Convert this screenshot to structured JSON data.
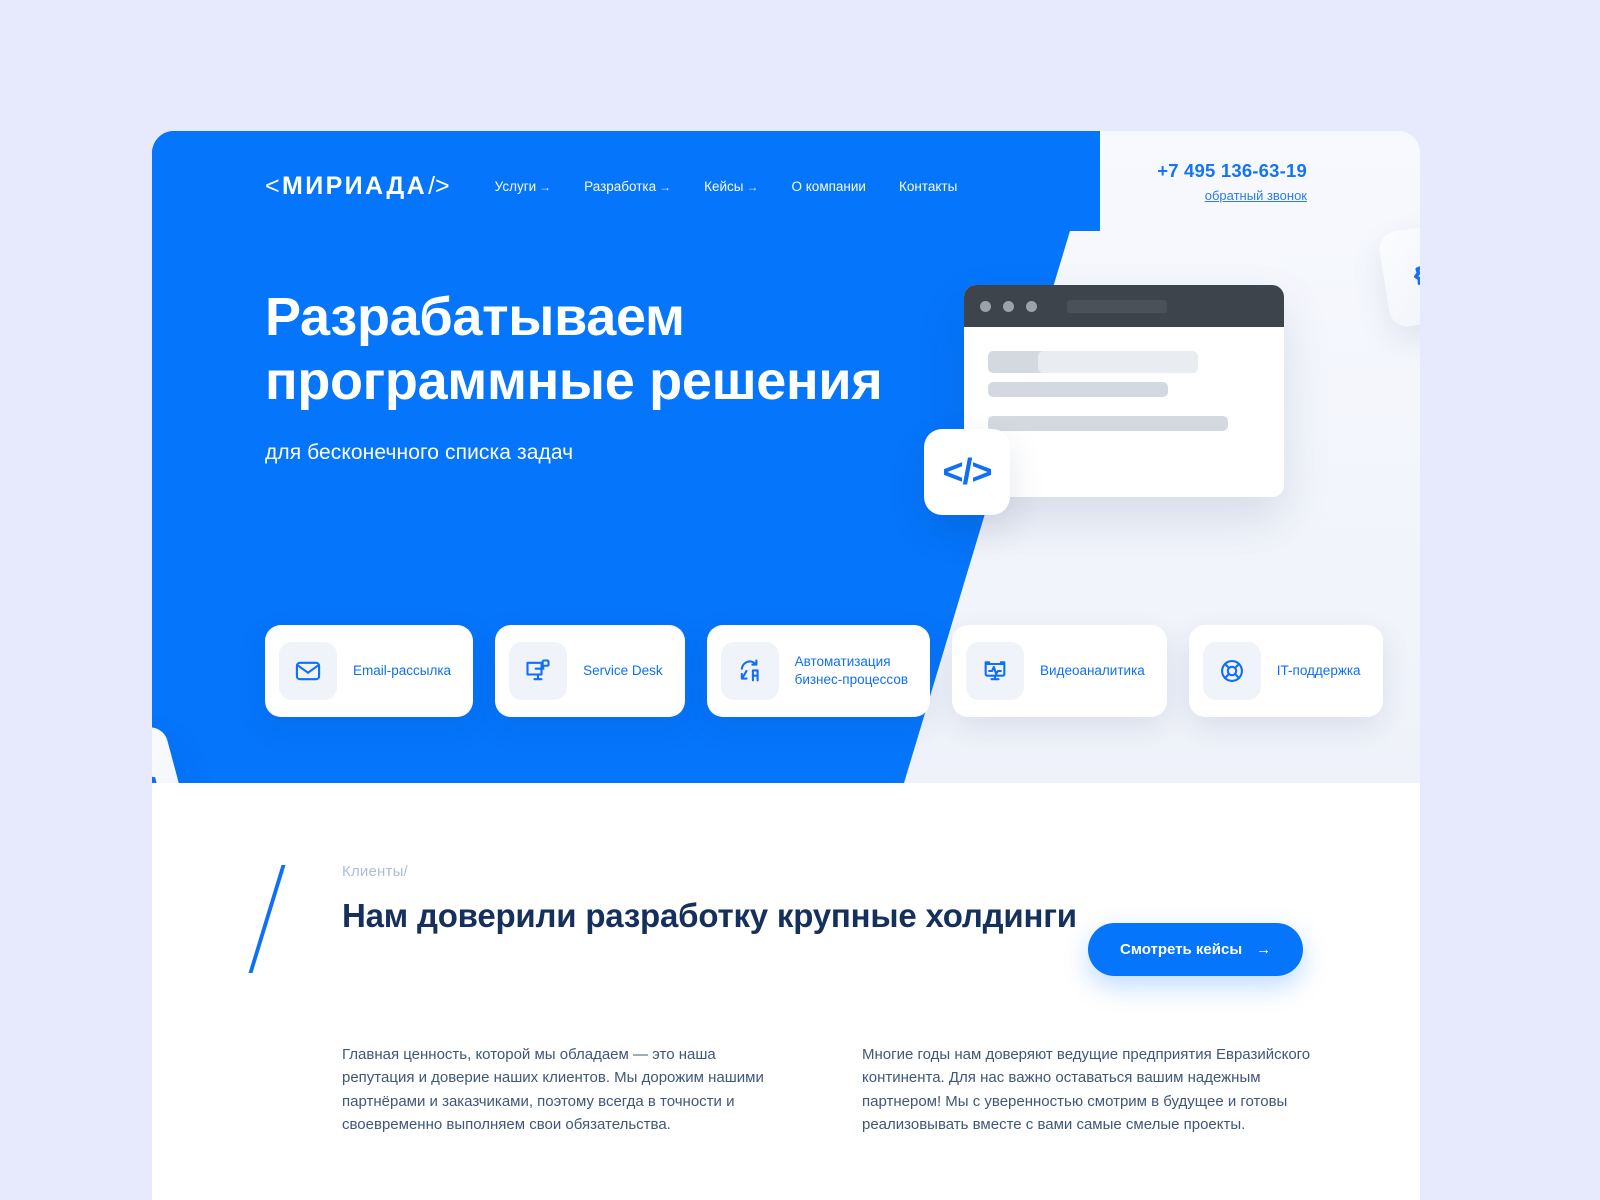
{
  "brand": {
    "logo_text": "МИРИАДА",
    "accent_color": "#0575FB",
    "dark_color": "#15305C"
  },
  "nav": {
    "items": [
      {
        "label": "Услуги",
        "arrow": "→"
      },
      {
        "label": "Разработка",
        "arrow": "→"
      },
      {
        "label": "Кейсы",
        "arrow": "→"
      },
      {
        "label": "О компании",
        "arrow": ""
      },
      {
        "label": "Контакты",
        "arrow": ""
      }
    ]
  },
  "contact": {
    "phone": "+7 495 136-63-19",
    "callback": "обратный звонок"
  },
  "hero": {
    "headline": "Разрабатываем программные решения",
    "subhead": "для бесконечного списка задач",
    "code_symbol": "</>",
    "code_symbol_bottom": "</>"
  },
  "services": [
    {
      "label": "Email-рассылка",
      "icon": "envelope-icon"
    },
    {
      "label": "Service Desk",
      "icon": "monitor-ticket-icon"
    },
    {
      "label": "Автоматизация\nбизнес-процессов",
      "icon": "automation-loop-icon"
    },
    {
      "label": "Видеоаналитика",
      "icon": "monitor-pulse-icon"
    },
    {
      "label": "IT-поддержка",
      "icon": "lifebuoy-icon"
    }
  ],
  "clients": {
    "eyebrow": "Клиенты/",
    "title": "Нам доверили разработку крупные холдинги",
    "cta_label": "Смотреть кейсы",
    "cta_arrow": "→",
    "paragraph_left": "Главная ценность, которой мы обладаем — это наша репутация и доверие наших клиентов. Мы дорожим нашими партнёрами и заказчиками, поэтому всегда в точности и своевременно выполняем свои обязательства.",
    "paragraph_right": "Многие годы нам доверяют ведущие предприятия Евразийского континента. Для нас важно оставаться вашим надежным партнером! Мы с уверенностью смотрим в будущее и готовы реализовывать вместе с вами самые смелые проекты."
  }
}
